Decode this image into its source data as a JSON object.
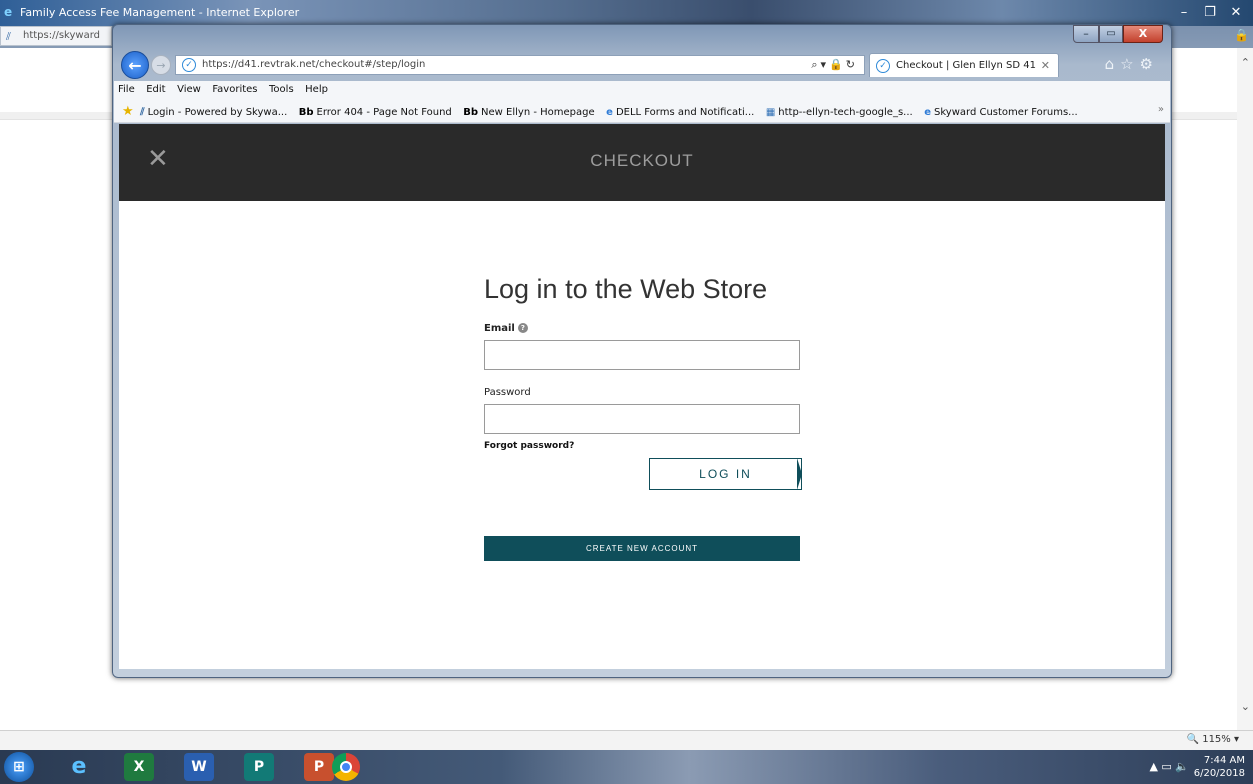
{
  "outer_window": {
    "title": "Family Access Fee Management - Internet Explorer",
    "address_text": "https://skyward",
    "zoom": "115%"
  },
  "browser": {
    "url": "https://d41.revtrak.net/checkout#/step/login",
    "tab_title": "Checkout | Glen Ellyn SD 41",
    "menu": [
      "File",
      "Edit",
      "View",
      "Favorites",
      "Tools",
      "Help"
    ],
    "favorites": [
      {
        "icon": "skyward-icon",
        "label": "Login - Powered by Skywa..."
      },
      {
        "icon": "blackboard-icon",
        "label": "Error 404 - Page Not Found"
      },
      {
        "icon": "blackboard-icon",
        "label": "New Ellyn - Homepage"
      },
      {
        "icon": "ie-icon",
        "label": "DELL Forms and Notificati..."
      },
      {
        "icon": "page-icon",
        "label": "http--ellyn-tech-google_s..."
      },
      {
        "icon": "ie-icon",
        "label": "Skyward Customer Forums..."
      }
    ],
    "bb_label": "Bb"
  },
  "page": {
    "header_title": "CHECKOUT",
    "login_title": "Log in to the Web Store",
    "email_label": "Email",
    "password_label": "Password",
    "forgot_label": "Forgot password?",
    "login_button": "LOG IN",
    "create_button": "CREATE NEW ACCOUNT"
  },
  "taskbar": {
    "time": "7:44 AM",
    "date": "6/20/2018",
    "apps": [
      "ie-icon",
      "excel-icon",
      "word-icon",
      "publisher-icon",
      "powerpoint-icon",
      "chrome-icon"
    ]
  },
  "colors": {
    "accent": "#0f4e5a",
    "header_bg": "#2a2a2a"
  }
}
